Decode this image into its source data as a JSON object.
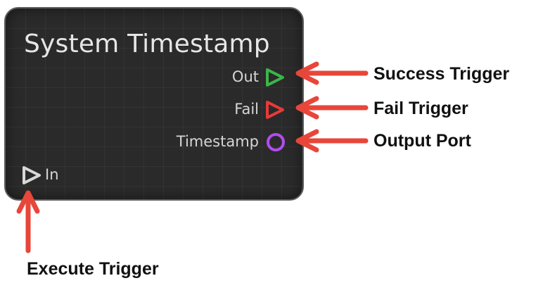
{
  "node": {
    "title": "System Timestamp",
    "ports": {
      "out": {
        "label": "Out",
        "color": "#3cb54a"
      },
      "fail": {
        "label": "Fail",
        "color": "#e83a3a"
      },
      "timestamp": {
        "label": "Timestamp",
        "color": "#b04dee"
      },
      "in": {
        "label": "In",
        "color": "#d8d8d8"
      }
    },
    "background": "#2a2a2a"
  },
  "annotations": {
    "success": "Success Trigger",
    "fail": "Fail Trigger",
    "output": "Output Port",
    "execute": "Execute Trigger",
    "arrow_color": "#e8463a"
  }
}
